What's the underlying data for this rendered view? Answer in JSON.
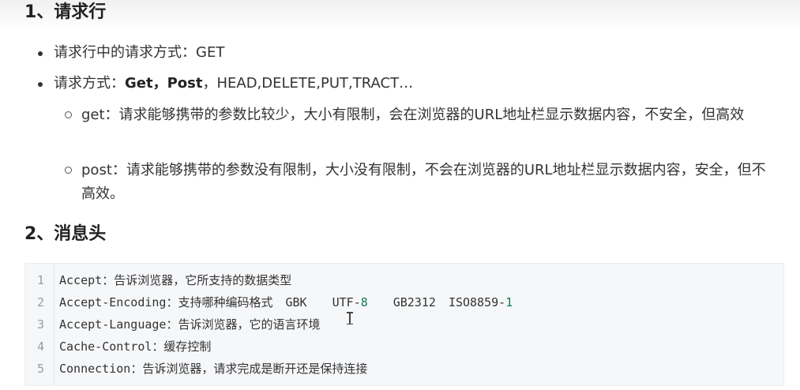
{
  "sections": [
    {
      "title": "1、请求行"
    },
    {
      "title": "2、消息头"
    }
  ],
  "request_line": {
    "bullet1": "请求行中的请求方式：GET",
    "bullet2_prefix": "请求方式：",
    "bullet2_bold": "Get，Post",
    "bullet2_rest": "，HEAD,DELETE,PUT,TRACT…",
    "sub_get": "get：请求能够携带的参数比较少，大小有限制，会在浏览器的URL地址栏显示数据内容，不安全，但高效",
    "sub_post": "post：请求能够携带的参数没有限制，大小没有限制，不会在浏览器的URL地址栏显示数据内容，安全，但不高效。"
  },
  "code": {
    "lines": [
      {
        "num": "1",
        "key": "Accept",
        "sep": "：",
        "desc": "告诉浏览器，它所支持的数据类型"
      },
      {
        "num": "2",
        "key_a": "Accept",
        "dash": "-",
        "key_b": "Encoding",
        "sep": "：",
        "desc": "支持哪种编码格式",
        "enc1": "GBK",
        "enc2_a": "UTF",
        "enc2_dash": "-",
        "enc2_num": "8",
        "enc3": "GB2312",
        "enc4_a": "ISO8859",
        "enc4_dash": "-",
        "enc4_num": "1"
      },
      {
        "num": "3",
        "key_a": "Accept",
        "dash": "-",
        "key_b": "Language",
        "sep": "：",
        "desc": "告诉浏览器，它的语言环境"
      },
      {
        "num": "4",
        "key_a": "Cache",
        "dash": "-",
        "key_b": "Control",
        "sep": "：",
        "desc": "缓存控制"
      },
      {
        "num": "5",
        "key": "Connection",
        "sep": "：",
        "desc": "告诉浏览器，请求完成是断开还是保持连接"
      }
    ]
  }
}
